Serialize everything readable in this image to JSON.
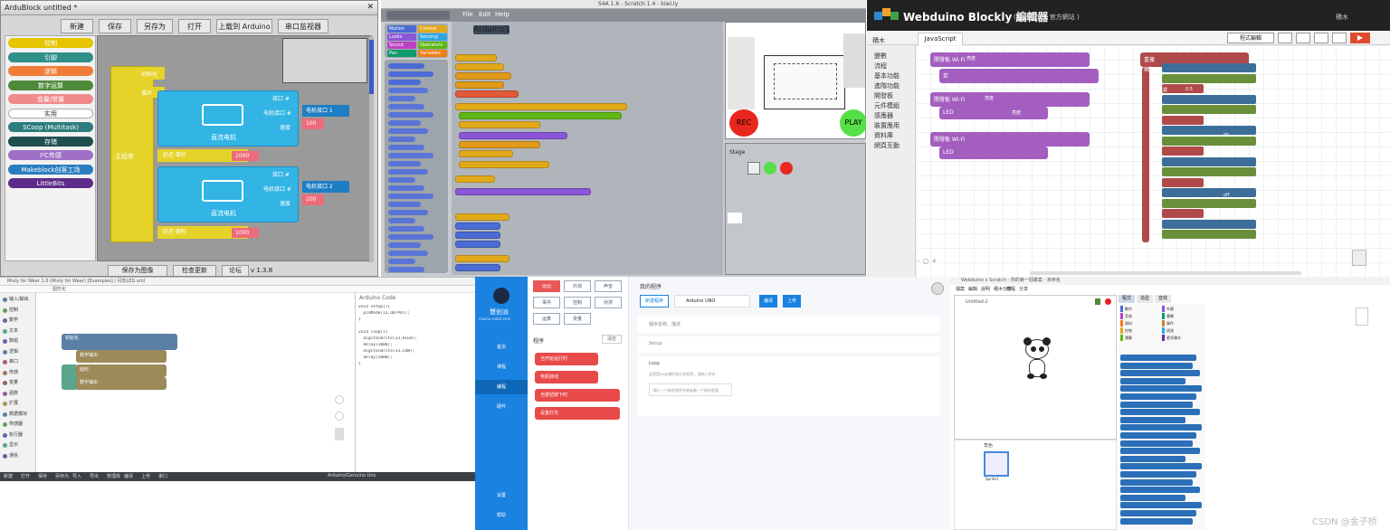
{
  "ardublock": {
    "title": "ArduBlock untitled *",
    "toolbar": [
      "新建",
      "保存",
      "另存为",
      "打开",
      "上载到 Arduino",
      "串口监视器"
    ],
    "categories": [
      {
        "label": "控制",
        "color": "#e6c400"
      },
      {
        "label": "引脚",
        "color": "#2f8f89"
      },
      {
        "label": "逻辑",
        "color": "#f07d37"
      },
      {
        "label": "数字运算",
        "color": "#4f8a3a"
      },
      {
        "label": "变量/常量",
        "color": "#f08a8a"
      },
      {
        "label": "实用",
        "color": "#ffffff"
      },
      {
        "label": "SCoop (Multitask)",
        "color": "#2c7d7d"
      },
      {
        "label": "存储",
        "color": "#1f4f4f"
      },
      {
        "label": "I²C传感",
        "color": "#a070c8"
      },
      {
        "label": "Makeblock创客工场",
        "color": "#2a7ec0"
      },
      {
        "label": "LittleBits",
        "color": "#5e2b8a"
      }
    ],
    "canvas": {
      "main_label": "主程序",
      "loop_label": "循环",
      "setup_label": "初始化",
      "motor1": {
        "title": "直流电机",
        "pin1": "接口 #",
        "pin2": "电机接口 #",
        "speed": "速度",
        "pin_val": "电机接口 1",
        "speed_val": "100"
      },
      "motor2": {
        "title": "直流电机",
        "pin1": "接口 #",
        "pin2": "电机接口 #",
        "speed": "速度",
        "pin_val": "电机接口 2",
        "speed_val": "100"
      },
      "delay1": "延迟 毫秒",
      "delay1_val": "1000",
      "delay2": "延迟 毫秒",
      "delay2_val": "1000"
    },
    "bottom_buttons": [
      "保存为图像",
      "检查更新",
      "论坛"
    ],
    "version": "v 1.3.8"
  },
  "s4a": {
    "title": "S4A 1.6 - Scratch 1.4 - kiwi.ly",
    "menu": [
      "File",
      "Edit",
      "Help"
    ],
    "categories": [
      "Motion",
      "Control",
      "Looks",
      "Sensing",
      "Sound",
      "Operators",
      "Pen",
      "Variables"
    ],
    "sprite": "Arduino1",
    "rec_label": "REC",
    "play_label": "PLAY",
    "stage_label": "Stage"
  },
  "webduino": {
    "title": "Webduino Blockly 編輯器",
    "subtitle": "( 教學範例 | 官方網站 )",
    "top_btns": [
      "程式碼",
      "JavaScript",
      "積木"
    ],
    "toolbar": [
      "程式編輯"
    ],
    "sidebar": [
      "積木",
      "變數",
      "流程",
      "基本功能",
      "進階功能",
      "開發板",
      "元件模組",
      "感應器",
      "裝置應用",
      "資料庫",
      "網頁互動"
    ],
    "tab_js": "JavaScript",
    "zoom": [
      "-",
      "○",
      "+"
    ],
    "block_labels": [
      "開發板 Wi-Fi",
      "若",
      "LED",
      "亮度",
      "狀態",
      "重複",
      "執行",
      "延遲",
      "0.5",
      "秒",
      "on",
      "off"
    ]
  },
  "mixly": {
    "title": "Mixly for Wear 1.0 (Mixly for Wear) [Examples] / 闪烁LED.xml",
    "sidebar": [
      "输入/输出",
      "控制",
      "数学",
      "文本",
      "数组",
      "逻辑",
      "串口",
      "传感",
      "变量",
      "函数",
      "扩展",
      "数据模块",
      "传感器",
      "执行器",
      "显示",
      "通信"
    ],
    "code_title": "Arduino Code",
    "code_lines": [
      "void setup(){",
      "  pinMode(13,OUTPUT);",
      "}",
      "",
      "void loop(){",
      "  digitalWrite(13,HIGH);",
      "  delay(1000);",
      "  digitalWrite(13,LOW);",
      "  delay(1000);",
      "}"
    ],
    "bottom": [
      "新建",
      "打开",
      "保存",
      "另存为",
      "导入",
      "导出",
      "管理库",
      "编译",
      "上传",
      "串口"
    ],
    "board": "Arduino/Genuino Uno",
    "tab": "图形化",
    "block_labels": [
      "初始化",
      "数字输出",
      "高",
      "延时",
      "毫秒",
      "1000",
      "低"
    ]
  },
  "mind": {
    "brand": "慧创派",
    "site": "xiaohu-robot.com",
    "nav": [
      "首页",
      "课程",
      "编程",
      "硬件",
      "设置",
      "帮助"
    ],
    "palette_btns": [
      "运动",
      "外观",
      "声音",
      "事件",
      "控制",
      "侦测",
      "运算",
      "变量"
    ],
    "section_title": "程序",
    "section_btn": "清空",
    "blocks": [
      "当开始运行时",
      "电机转动",
      "当按钮按下时",
      "设置灯光"
    ],
    "right": {
      "header": "我的程序",
      "tabs": [
        "新建程序",
        "Arduino UNO"
      ],
      "items": [
        "程序名称、描述",
        "Setup",
        "Loop"
      ],
      "hint": "这里是Loop循环执行的程序，请拖入积木",
      "input": "输入一个新的程序名称或者一个新的变量",
      "btns": [
        "编译",
        "上传"
      ]
    }
  },
  "scratch": {
    "title": "Webduino x Scratch - 你的第一個專案 - 未命名",
    "menu": [
      "檔案",
      "編輯",
      "說明",
      "積木分享",
      "教程",
      "分享"
    ],
    "stage_title": "Untitled-2",
    "tabs": [
      "程式",
      "造型",
      "音效"
    ],
    "categories": [
      "動作",
      "外觀",
      "音效",
      "畫筆",
      "資料",
      "事件",
      "控制",
      "偵測",
      "運算",
      "更多積木"
    ],
    "sprite": "Sprite1",
    "sprite_label": "角色",
    "watermark": "CSDN @金子桥"
  }
}
